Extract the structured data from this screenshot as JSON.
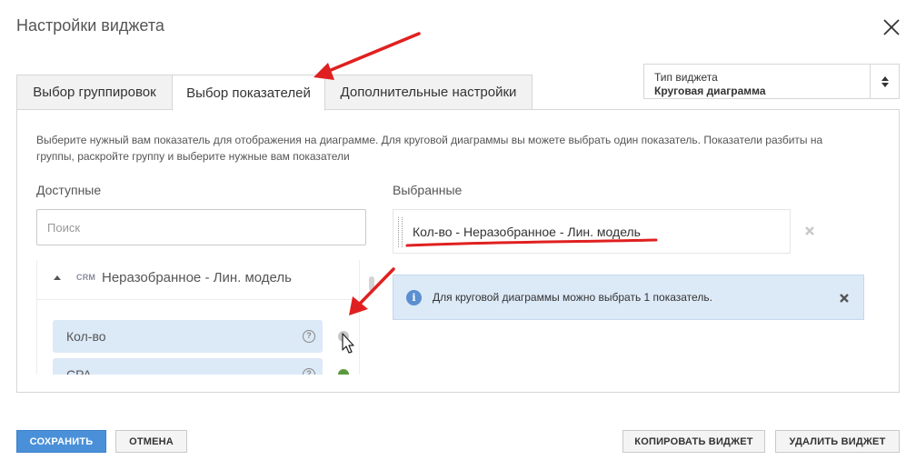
{
  "dialog": {
    "title": "Настройки виджета"
  },
  "widget_type": {
    "label": "Тип виджета",
    "value": "Круговая диаграмма"
  },
  "tabs": [
    {
      "label": "Выбор группировок"
    },
    {
      "label": "Выбор показателей",
      "active": true
    },
    {
      "label": "Дополнительные настройки"
    }
  ],
  "panel": {
    "description": "Выберите нужный вам показатель для отображения на диаграмме. Для круговой диаграммы вы можете выбрать один показатель. Показатели разбиты на группы, раскройте группу и выберите нужные вам показатели",
    "available_label": "Доступные",
    "selected_label": "Выбранные",
    "search_placeholder": "Поиск",
    "group": {
      "badge": "CRM",
      "name": "Неразобранное - Лин. модель"
    },
    "metrics": [
      {
        "name": "Кол-во"
      },
      {
        "name": "CPA"
      }
    ],
    "selected_item": "Кол-во - Неразобранное - Лин. модель",
    "info_text": "Для круговой диаграммы можно выбрать 1 показатель."
  },
  "buttons": {
    "save": "СОХРАНИТЬ",
    "cancel": "ОТМЕНА",
    "copy": "КОПИРОВАТЬ ВИДЖЕТ",
    "delete": "УДАЛИТЬ ВИДЖЕТ"
  },
  "colors": {
    "primary_button": "#4a90d9",
    "highlight": "#dce9f7",
    "annotation_red": "#e02020",
    "add_active": "#5a9a3c"
  }
}
